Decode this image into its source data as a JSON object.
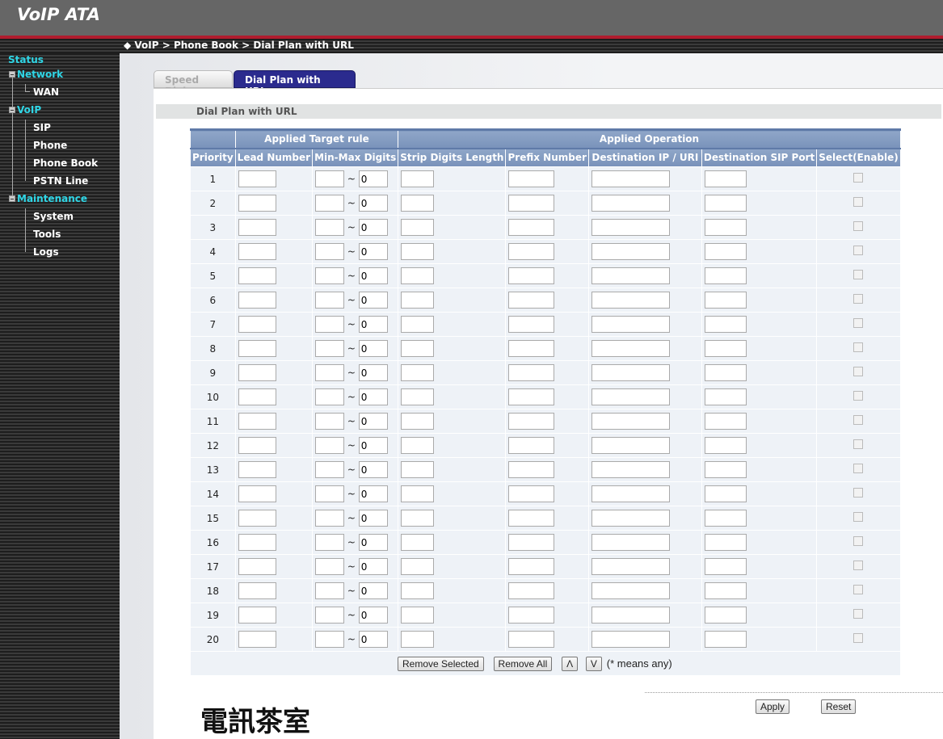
{
  "header": {
    "title": "VoIP ATA"
  },
  "breadcrumb": "◆ VoIP > Phone Book > Dial Plan with URL",
  "sidebar": {
    "status": "Status",
    "network": "Network",
    "wan": "WAN",
    "voip": "VoIP",
    "sip": "SIP",
    "phone": "Phone",
    "phone_book": "Phone Book",
    "pstn_line": "PSTN Line",
    "maintenance": "Maintenance",
    "system": "System",
    "tools": "Tools",
    "logs": "Logs"
  },
  "tabs": [
    {
      "label": "Speed Dial",
      "active": false
    },
    {
      "label": "Dial Plan with URL",
      "active": true
    }
  ],
  "section_title": "Dial Plan with URL",
  "table": {
    "group_headers": {
      "target": "Applied Target rule",
      "operation": "Applied Operation"
    },
    "columns": [
      "Priority",
      "Lead Number",
      "Min-Max Digits",
      "Strip Digits Length",
      "Prefix Number",
      "Destination IP / URI",
      "Destination SIP Port",
      "Select(Enable)"
    ],
    "range_separator": "~",
    "rows": [
      {
        "priority": "1",
        "max": "0"
      },
      {
        "priority": "2",
        "max": "0"
      },
      {
        "priority": "3",
        "max": "0"
      },
      {
        "priority": "4",
        "max": "0"
      },
      {
        "priority": "5",
        "max": "0"
      },
      {
        "priority": "6",
        "max": "0"
      },
      {
        "priority": "7",
        "max": "0"
      },
      {
        "priority": "8",
        "max": "0"
      },
      {
        "priority": "9",
        "max": "0"
      },
      {
        "priority": "10",
        "max": "0"
      },
      {
        "priority": "11",
        "max": "0"
      },
      {
        "priority": "12",
        "max": "0"
      },
      {
        "priority": "13",
        "max": "0"
      },
      {
        "priority": "14",
        "max": "0"
      },
      {
        "priority": "15",
        "max": "0"
      },
      {
        "priority": "16",
        "max": "0"
      },
      {
        "priority": "17",
        "max": "0"
      },
      {
        "priority": "18",
        "max": "0"
      },
      {
        "priority": "19",
        "max": "0"
      },
      {
        "priority": "20",
        "max": "0"
      }
    ]
  },
  "actions": {
    "remove_selected": "Remove Selected",
    "remove_all": "Remove All",
    "up": "Λ",
    "down": "V",
    "note": "(* means any)"
  },
  "footer": {
    "apply": "Apply",
    "reset": "Reset"
  },
  "watermark": "電訊茶室",
  "colors": {
    "header": "#666666",
    "accent_red": "#b01c2e",
    "active_tab": "#2b2b8e",
    "nav_link": "#2fd6e6",
    "table_header": "#7992ba"
  }
}
